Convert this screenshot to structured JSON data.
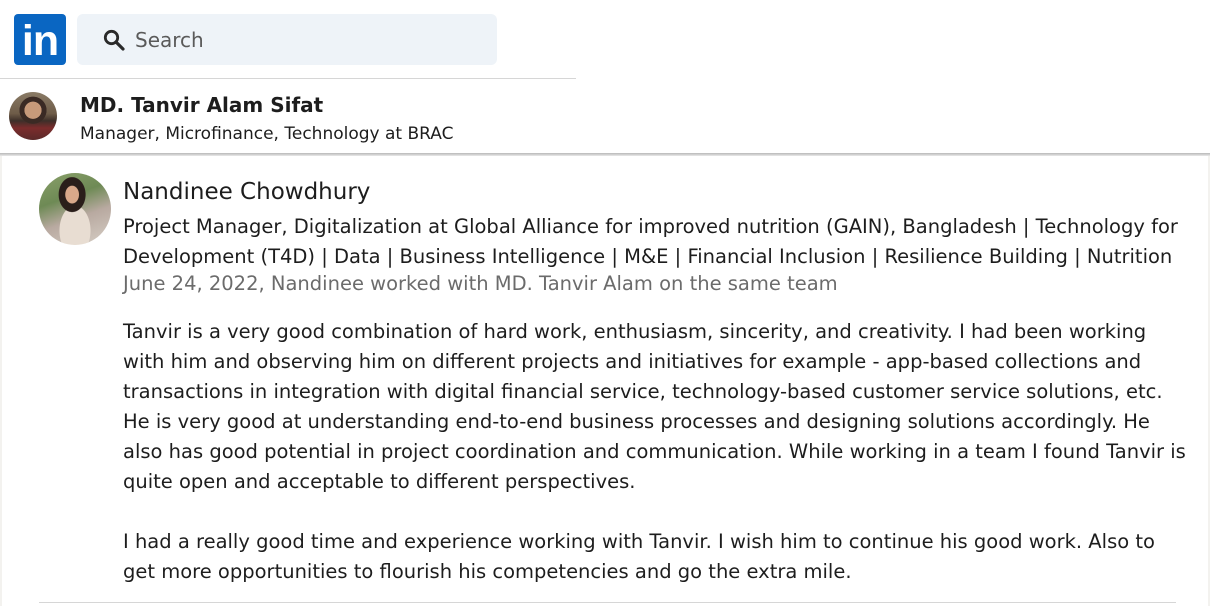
{
  "topbar": {
    "logo_text": "in",
    "search": {
      "placeholder": "Search",
      "icon": "search-icon"
    }
  },
  "profile": {
    "name": "MD. Tanvir Alam Sifat",
    "headline": "Manager, Microfinance, Technology at BRAC"
  },
  "recommendation": {
    "author_name": "Nandinee Chowdhury",
    "author_headline": "Project Manager, Digitalization at Global Alliance for improved nutrition (GAIN), Bangladesh | Technology for Development (T4D) | Data | Business Intelligence | M&E | Financial Inclusion | Resilience Building | Nutrition",
    "meta": "June 24, 2022, Nandinee worked with MD. Tanvir Alam on the same team",
    "paragraphs": [
      "Tanvir is a very good combination of hard work, enthusiasm, sincerity, and creativity. I had been working with him and observing him on different projects and initiatives for example - app-based collections and transactions in integration with digital financial service, technology-based customer service solutions, etc. He is very good at understanding end-to-end business processes and designing solutions accordingly. He also has good potential in project coordination and communication. While working in a team I found Tanvir is quite open and acceptable to different perspectives.",
      "I had a really good time and experience working with Tanvir. I wish him to continue his good work. Also to get more opportunities to flourish his competencies and go the extra mile."
    ]
  },
  "colors": {
    "brand": "#0a66c2",
    "search_bg": "#eef3f8",
    "meta_text": "#6b6b6b"
  }
}
